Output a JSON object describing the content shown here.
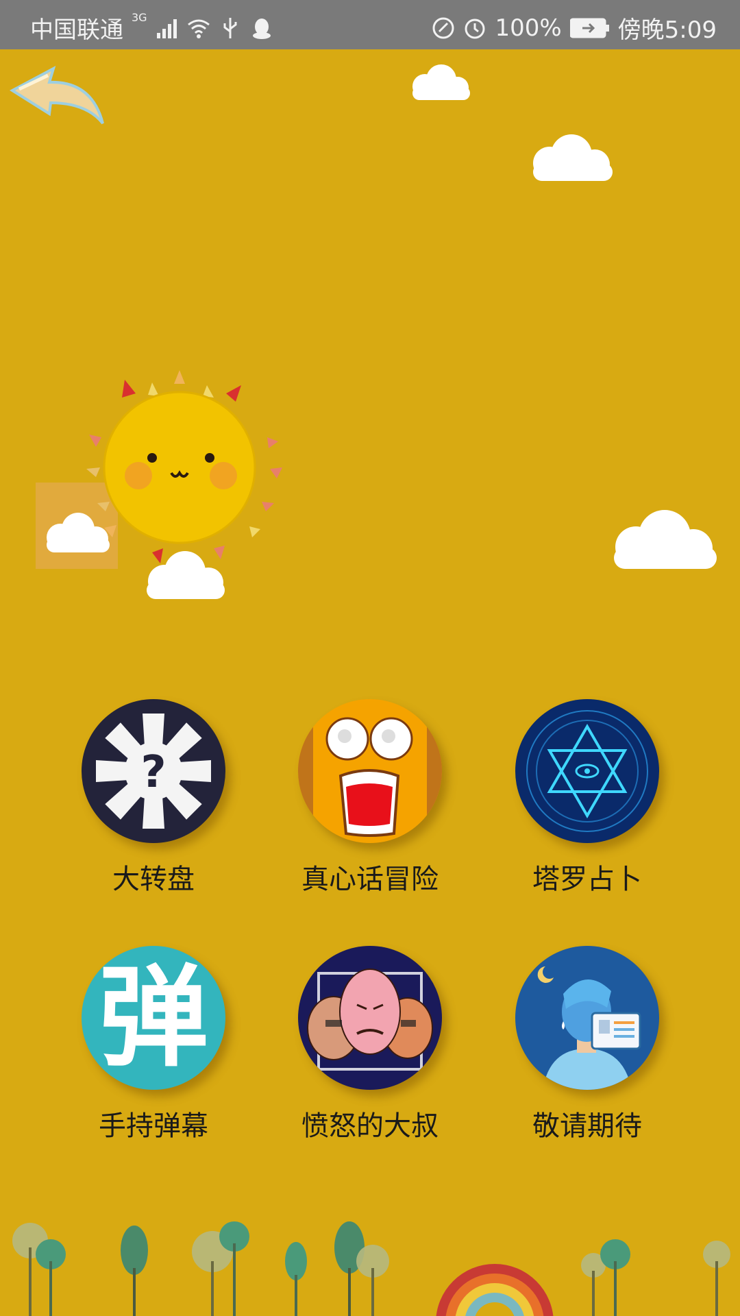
{
  "status_bar": {
    "carrier": "中国联通",
    "network": "3G",
    "battery": "100%",
    "time": "傍晚5:09"
  },
  "games": [
    {
      "label": "大转盘",
      "icon": "wheel-icon"
    },
    {
      "label": "真心话冒险",
      "icon": "shocked-face-icon"
    },
    {
      "label": "塔罗占卜",
      "icon": "hexagram-icon"
    },
    {
      "label": "手持弹幕",
      "icon": "danmu-icon",
      "icon_text": "弹"
    },
    {
      "label": "愤怒的大叔",
      "icon": "angry-faces-icon"
    },
    {
      "label": "敬请期待",
      "icon": "coming-soon-icon"
    }
  ],
  "colors": {
    "background": "#d8aa12",
    "status_bar": "#7a7a7a",
    "sun": "#f2c300"
  }
}
